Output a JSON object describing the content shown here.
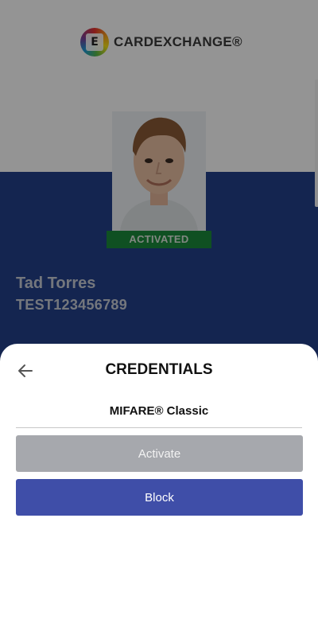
{
  "card": {
    "logo_text": "CARDEXCHANGE®",
    "logo_mark": "E",
    "status": "ACTIVATED",
    "holder_name": "Tad Torres",
    "holder_id": "TEST123456789",
    "colors": {
      "card_bottom": "#24408a",
      "status_badge": "#1a8a3c"
    }
  },
  "sheet": {
    "title": "CREDENTIALS",
    "back_icon": "arrow-left-icon",
    "credential_type": "MIFARE® Classic",
    "activate_label": "Activate",
    "block_label": "Block",
    "colors": {
      "activate_button": "#a6a8ad",
      "block_button": "#3f4ea8"
    }
  }
}
